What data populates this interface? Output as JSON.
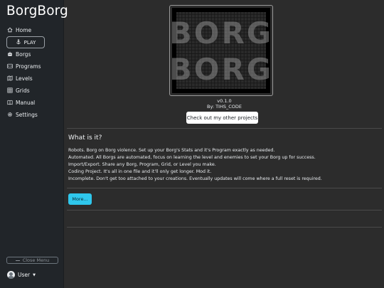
{
  "sidebar": {
    "brand": "BorgBorg",
    "play_label": "PLAY",
    "items": [
      {
        "label": "Home",
        "icon": "home-icon"
      },
      {
        "label": "Borgs",
        "icon": "robot-icon"
      },
      {
        "label": "Programs",
        "icon": "code-icon"
      },
      {
        "label": "Levels",
        "icon": "map-icon"
      },
      {
        "label": "Grids",
        "icon": "grid-icon"
      },
      {
        "label": "Manual",
        "icon": "book-icon"
      },
      {
        "label": "Settings",
        "icon": "gear-icon"
      }
    ],
    "close_menu_label": "Close Menu",
    "user_label": "User"
  },
  "main": {
    "version": "v0.1.0",
    "byline": "By: TIHS_CODE",
    "projects_button": "Check out my other projects",
    "section_title": "What is it?",
    "description": [
      "Robots. Borg on Borg violence. Set up your Borg's Stats and it's Program exactly as needed.",
      "Automated. All Borgs are automated, focus on learning the level and enemies to set your Borg up for success.",
      "Import/Export. Share any Borg, Program, Grid, or Level you make.",
      "Coding Project. It's all in one file and it'll only get longer. Mod it.",
      "Incomplete. Don't get too attached to your creations. Eventually updates will come where a full reset is required."
    ],
    "more_button": "More..."
  },
  "logo_text": [
    "BORG",
    "BORG"
  ],
  "colors": {
    "sidebar_bg": "#212529",
    "main_bg": "#2c2c2c",
    "accent": "#2fc7ec"
  }
}
